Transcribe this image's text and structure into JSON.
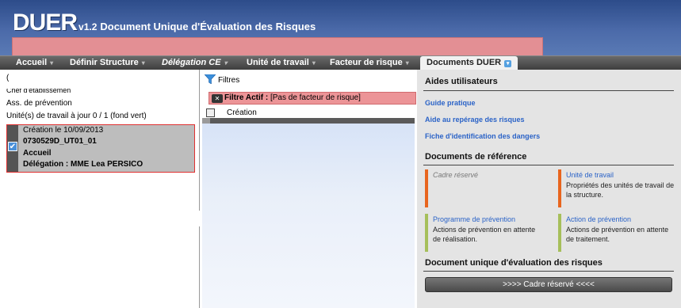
{
  "app": {
    "name": "DUER",
    "version": "v1.2",
    "subtitle": "Document Unique d'Évaluation des Risques"
  },
  "colors": {
    "header_blue": "#3d5c9b",
    "accent_pink": "#e38f94",
    "link_blue": "#2b63c7",
    "tile_orange": "#e8651e",
    "tile_green": "#a6bf5a"
  },
  "menu": [
    {
      "label": "Accueil"
    },
    {
      "label": "Définir Structure"
    },
    {
      "label": "Délégation CE"
    },
    {
      "label": "Unité de travail"
    },
    {
      "label": "Facteur de risque"
    },
    {
      "label": "Documents DUER",
      "active": true
    }
  ],
  "left": {
    "line1": "(",
    "line2": "Chef d'établissemen",
    "line3": "Ass. de prévention",
    "line4": "Unité(s) de travail à jour 0 / 1 (fond vert)",
    "card": {
      "created": "Création le 10/09/2013",
      "code": "0730529D_UT01_01",
      "name": "Accueil",
      "delegation": "Délégation : MME Lea PERSICO"
    }
  },
  "middle": {
    "filters_label": "Filtres",
    "active_filter_label": "Filtre Actif :",
    "active_filter_value": "[Pas de facteur de risque]",
    "creation_label": "Création"
  },
  "right": {
    "aides_title": "Aides utilisateurs",
    "aides_links": [
      "Guide pratique",
      "Aide au repérage des risques",
      "Fiche d'identification des dangers"
    ],
    "ref_title": "Documents de référence",
    "tiles": [
      {
        "title": "Cadre réservé",
        "desc": "",
        "color": "#e8651e",
        "style": "grey"
      },
      {
        "title": "Unité de travail",
        "desc": "Propriétés des unités de travail de la structure.",
        "color": "#e8651e",
        "style": "link"
      },
      {
        "title": "Programme de prévention",
        "desc": "Actions de prévention en attente de réalisation.",
        "color": "#a6bf5a",
        "style": "link"
      },
      {
        "title": "Action de prévention",
        "desc": "Actions de prévention en attente de traitement.",
        "color": "#a6bf5a",
        "style": "link"
      }
    ],
    "duer_title": "Document unique d'évaluation des risques",
    "cta_label": ">>>> Cadre réservé <<<<"
  }
}
